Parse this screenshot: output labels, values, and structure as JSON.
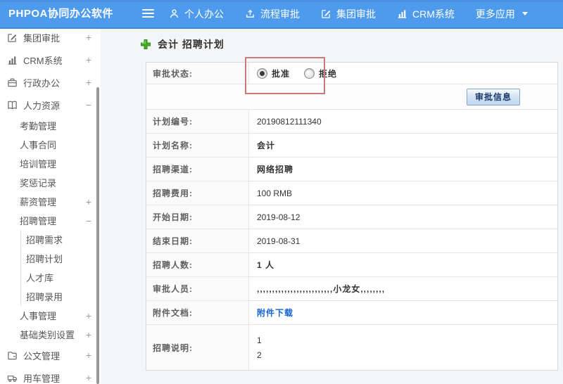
{
  "header": {
    "logo": "PHPOA协同办公软件",
    "nav_items": [
      {
        "icon": "person-icon",
        "label": "个人办公"
      },
      {
        "icon": "flow-icon",
        "label": "流程审批"
      },
      {
        "icon": "edit-square-icon",
        "label": "集团审批"
      },
      {
        "icon": "bar-chart-icon",
        "label": "CRM系统"
      },
      {
        "icon": "",
        "label": "更多应用",
        "caret": true
      }
    ]
  },
  "sidebar": {
    "items": [
      {
        "label": "集团审批",
        "level": 1,
        "icon": "edit-square-icon",
        "expander": "+"
      },
      {
        "label": "CRM系统",
        "level": 1,
        "icon": "bar-chart-icon",
        "expander": "+"
      },
      {
        "label": "行政办公",
        "level": 1,
        "icon": "briefcase-icon",
        "expander": "+"
      },
      {
        "label": "人力资源",
        "level": 1,
        "icon": "book-icon",
        "expander": "−"
      },
      {
        "label": "考勤管理",
        "level": 2
      },
      {
        "label": "人事合同",
        "level": 2
      },
      {
        "label": "培训管理",
        "level": 2
      },
      {
        "label": "奖惩记录",
        "level": 2
      },
      {
        "label": "薪资管理",
        "level": 2,
        "expander": "+"
      },
      {
        "label": "招聘管理",
        "level": 2,
        "expander": "−"
      },
      {
        "label": "招聘需求",
        "level": 3
      },
      {
        "label": "招聘计划",
        "level": 3
      },
      {
        "label": "人才库",
        "level": 3
      },
      {
        "label": "招聘录用",
        "level": 3
      },
      {
        "label": "人事管理",
        "level": 2,
        "expander": "+"
      },
      {
        "label": "基础类别设置",
        "level": 2,
        "expander": "+"
      },
      {
        "label": "公文管理",
        "level": 1,
        "icon": "doc-icon",
        "expander": "+"
      },
      {
        "label": "用车管理",
        "level": 1,
        "icon": "car-icon",
        "expander": "+"
      }
    ]
  },
  "main": {
    "page_title": "会计 招聘计划",
    "approval": {
      "label": "审批状态:",
      "options": [
        {
          "label": "批准",
          "selected": true
        },
        {
          "label": "拒绝",
          "selected": false
        }
      ]
    },
    "approval_info_button": "审批信息",
    "fields": [
      {
        "label": "计划编号:",
        "value": "20190812111340"
      },
      {
        "label": "计划名称:",
        "value": "会计"
      },
      {
        "label": "招聘渠道:",
        "value": "网络招聘"
      },
      {
        "label": "招聘费用:",
        "value": "100 RMB"
      },
      {
        "label": "开始日期:",
        "value": "2019-08-12"
      },
      {
        "label": "结束日期:",
        "value": "2019-08-31"
      },
      {
        "label": "招聘人数:",
        "value": "1 人"
      },
      {
        "label": "审批人员:",
        "value": ",,,,,,,,,,,,,,,,,,,,,,,,,小龙女,,,,,,,,"
      },
      {
        "label": "附件文档:",
        "value": "附件下载",
        "type": "link"
      },
      {
        "label": "招聘说明:",
        "type": "multiline",
        "lines": [
          "1",
          "2"
        ]
      }
    ]
  },
  "colors": {
    "nav_blue": "#4e9bee",
    "accent_green": "#3fae26",
    "link_blue": "#1464d2",
    "annotation_red": "#c97a7a",
    "button_face": "#cfe1f3",
    "button_text": "#1c3a66"
  }
}
